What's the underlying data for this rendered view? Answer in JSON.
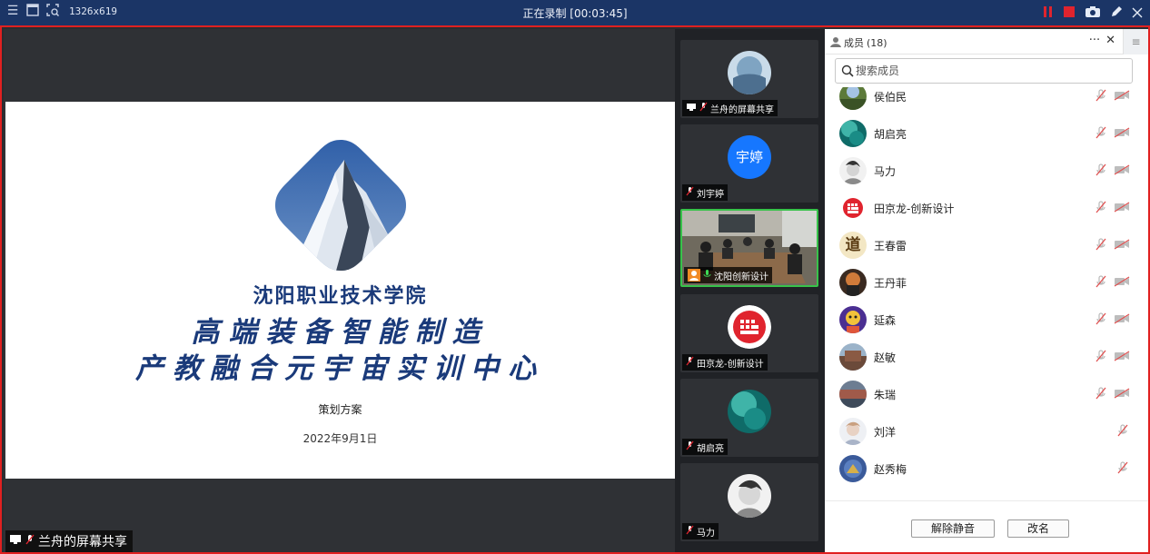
{
  "recorder": {
    "resolution": "1326x619",
    "status": "正在录制 [00:03:45]"
  },
  "slide": {
    "school": "沈阳职业技术学院",
    "line1": "高端装备智能制造",
    "line2": "产教融合元宇宙实训中心",
    "subtitle": "策划方案",
    "date": "2022年9月1日"
  },
  "share_label": "兰舟的屏幕共享",
  "video_tiles": [
    {
      "label": "兰舟的屏幕共享"
    },
    {
      "label": "刘宇婷",
      "avatar_text": "宇婷"
    },
    {
      "label": "沈阳创新设计"
    },
    {
      "label": "田京龙-创新设计"
    },
    {
      "label": "胡启亮"
    },
    {
      "label": "马力"
    }
  ],
  "members_panel": {
    "title": "成员",
    "count": "(18)",
    "search_placeholder": "搜索成员",
    "members": [
      {
        "name": "侯伯民"
      },
      {
        "name": "胡启亮"
      },
      {
        "name": "马力"
      },
      {
        "name": "田京龙-创新设计"
      },
      {
        "name": "王春雷",
        "avatar_text": "道"
      },
      {
        "name": "王丹菲"
      },
      {
        "name": "延森"
      },
      {
        "name": "赵敏"
      },
      {
        "name": "朱瑞"
      },
      {
        "name": "刘洋"
      },
      {
        "name": "赵秀梅"
      }
    ],
    "unmute_button": "解除静音",
    "rename_button": "改名"
  },
  "colors": {
    "recording_border": "#e02020",
    "accent_blue": "#1677ff",
    "active_tile": "#37c24a",
    "slide_title": "#1a3a7a"
  }
}
